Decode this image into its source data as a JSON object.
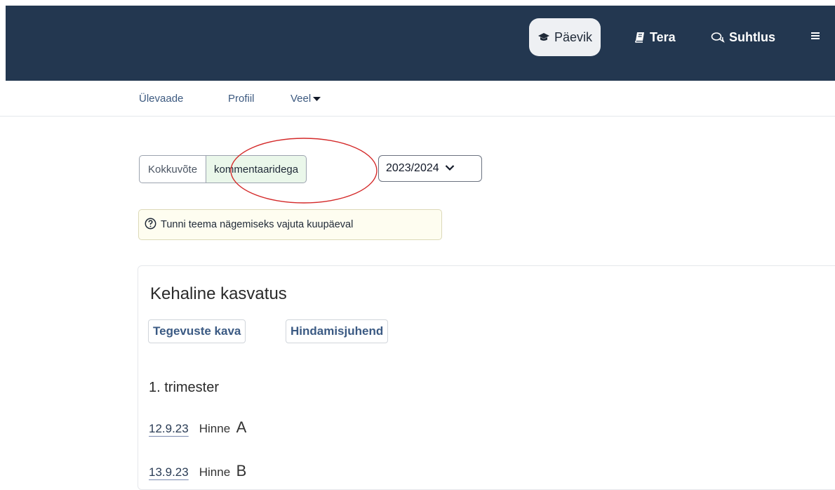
{
  "topnav": {
    "items": [
      {
        "label": "Päevik",
        "icon": "graduation-cap-icon",
        "active": true
      },
      {
        "label": "Tera",
        "icon": "book-icon",
        "active": false
      },
      {
        "label": "Suhtlus",
        "icon": "chat-icon",
        "active": false
      }
    ],
    "menu_icon": "hamburger-menu-icon"
  },
  "subnav": {
    "items": [
      "Ülevaade",
      "Profiil",
      "Veel"
    ]
  },
  "view_toggle": {
    "summary_label": "Kokkuvõte",
    "comments_label": "kommentaaridega"
  },
  "year_select": {
    "value": "2023/2024"
  },
  "hint": {
    "text": "Tunni teema nägemiseks vajuta kuupäeval"
  },
  "subject": {
    "title": "Kehaline kasvatus",
    "links": [
      "Tegevuste kava",
      "Hindamisjuhend"
    ],
    "term": "1. trimester",
    "grades": [
      {
        "date": "12.9.23",
        "label": "Hinne",
        "value": "A"
      },
      {
        "date": "13.9.23",
        "label": "Hinne",
        "value": "B"
      }
    ]
  },
  "colors": {
    "topbar": "#233750",
    "active_pill": "#eef0f3",
    "selected_segment": "#eaf7ea",
    "highlight": "#d42a2a"
  }
}
